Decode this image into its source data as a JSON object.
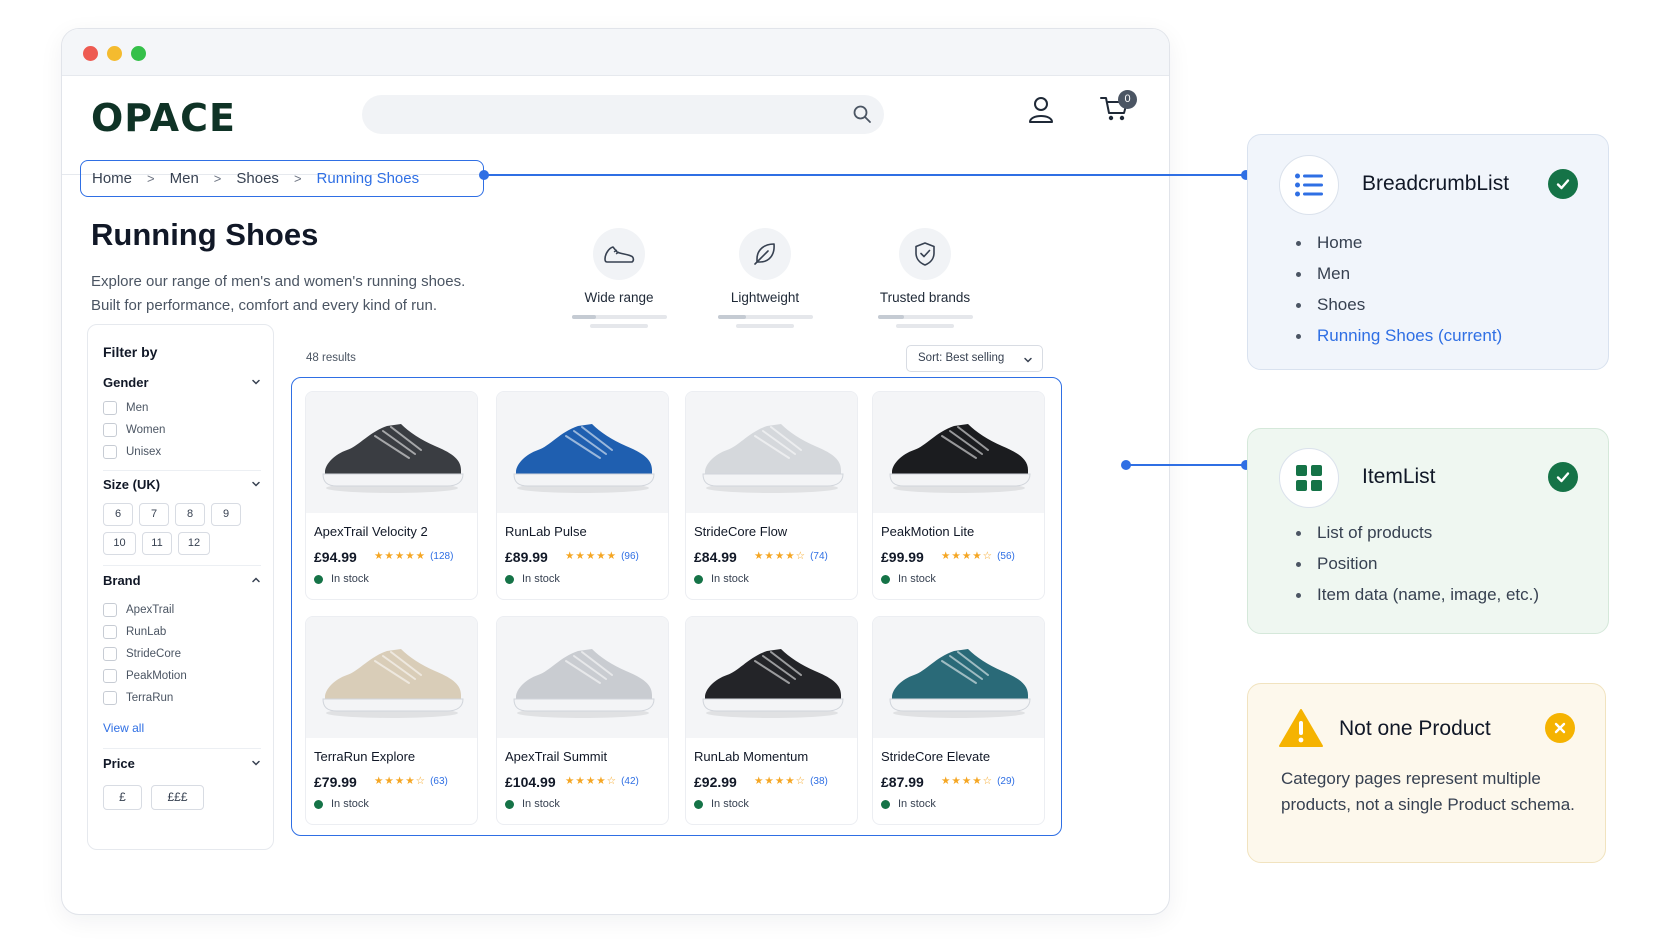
{
  "header": {
    "logo": "OPACE",
    "cart_count": "0"
  },
  "breadcrumb": [
    "Home",
    "Men",
    "Shoes",
    "Running Shoes"
  ],
  "page": {
    "title": "Running Shoes",
    "intro_line1": "Explore our range of men's and women's running shoes.",
    "intro_line2": "Built for performance, comfort and every kind of run."
  },
  "features": [
    {
      "label": "Wide range",
      "icon": "shoe-icon"
    },
    {
      "label": "Lightweight",
      "icon": "feather-icon"
    },
    {
      "label": "Trusted brands",
      "icon": "shield-check-icon"
    }
  ],
  "filter": {
    "title": "Filter by",
    "gender": {
      "label": "Gender",
      "options": [
        "Men",
        "Women",
        "Unisex"
      ]
    },
    "size": {
      "label": "Size (UK)",
      "options": [
        "6",
        "7",
        "8",
        "9",
        "10",
        "11",
        "12"
      ]
    },
    "brand": {
      "label": "Brand",
      "options": [
        "ApexTrail",
        "RunLab",
        "StrideCore",
        "PeakMotion",
        "TerraRun"
      ],
      "view_all": "View all"
    },
    "price": {
      "label": "Price",
      "low": "£",
      "high": "£££"
    }
  },
  "results_count": "48 results",
  "sort_label": "Sort: Best selling",
  "products": [
    {
      "name": "ApexTrail Velocity 2",
      "price": "£94.99",
      "stars": "★★★★★",
      "reviews": "(128)",
      "stock": "In stock",
      "color": "#3a3d42"
    },
    {
      "name": "RunLab Pulse",
      "price": "£89.99",
      "stars": "★★★★★",
      "reviews": "(96)",
      "stock": "In stock",
      "color": "#1f5fb0"
    },
    {
      "name": "StrideCore Flow",
      "price": "£84.99",
      "stars": "★★★★☆",
      "reviews": "(74)",
      "stock": "In stock",
      "color": "#d5d8dc"
    },
    {
      "name": "PeakMotion Lite",
      "price": "£99.99",
      "stars": "★★★★☆",
      "reviews": "(56)",
      "stock": "In stock",
      "color": "#1b1c1f"
    },
    {
      "name": "TerraRun Explore",
      "price": "£79.99",
      "stars": "★★★★☆",
      "reviews": "(63)",
      "stock": "In stock",
      "color": "#d9cdb8"
    },
    {
      "name": "ApexTrail Summit",
      "price": "£104.99",
      "stars": "★★★★☆",
      "reviews": "(42)",
      "stock": "In stock",
      "color": "#c9ccd1"
    },
    {
      "name": "RunLab Momentum",
      "price": "£92.99",
      "stars": "★★★★☆",
      "reviews": "(38)",
      "stock": "In stock",
      "color": "#232428"
    },
    {
      "name": "StrideCore Elevate",
      "price": "£87.99",
      "stars": "★★★★☆",
      "reviews": "(29)",
      "stock": "In stock",
      "color": "#2a6a78"
    }
  ],
  "panels": {
    "breadcrumb_list": {
      "title": "BreadcrumbList",
      "items": [
        "Home",
        "Men",
        "Shoes",
        "Running Shoes (current)"
      ]
    },
    "item_list": {
      "title": "ItemList",
      "items": [
        "List of products",
        "Position",
        "Item data (name, image, etc.)"
      ]
    },
    "not_product": {
      "title": "Not one Product",
      "body": "Category pages represent multiple products, not a single Product schema."
    }
  },
  "colors": {
    "accent": "#2f6fe4",
    "logo": "#0f3326",
    "success": "#157347",
    "warning": "#f5b301"
  }
}
